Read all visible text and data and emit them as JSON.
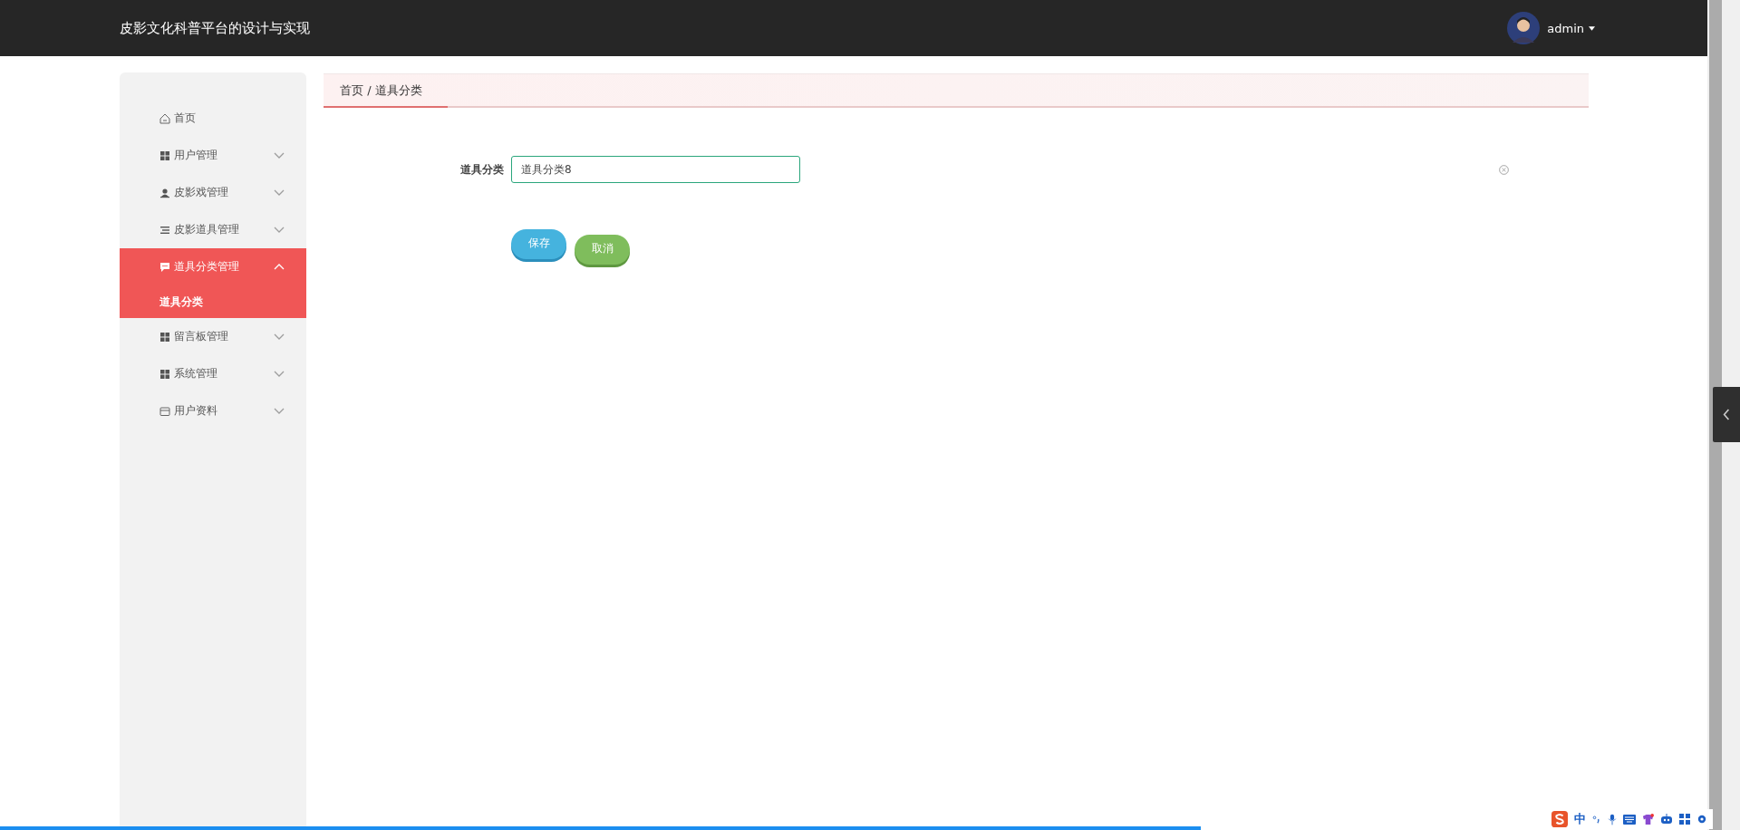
{
  "header": {
    "title": "皮影文化科普平台的设计与实现",
    "user": "admin"
  },
  "sidebar": {
    "items": [
      {
        "label": "首页",
        "kind": "home",
        "selected": false
      },
      {
        "label": "用户管理",
        "kind": "grid",
        "expanded": false,
        "selected": false
      },
      {
        "label": "皮影戏管理",
        "kind": "person",
        "expanded": false,
        "selected": false
      },
      {
        "label": "皮影道具管理",
        "kind": "list",
        "expanded": false,
        "selected": false
      },
      {
        "label": "道具分类管理",
        "kind": "chat",
        "expanded": true,
        "selected": true,
        "children": [
          {
            "label": "道具分类",
            "selected": true
          }
        ]
      },
      {
        "label": "留言板管理",
        "kind": "grid",
        "expanded": false,
        "selected": false
      },
      {
        "label": "系统管理",
        "kind": "grid",
        "expanded": false,
        "selected": false
      },
      {
        "label": "用户资料",
        "kind": "card",
        "expanded": false,
        "selected": false
      }
    ]
  },
  "breadcrumb": "首页 / 道具分类",
  "video_progress": {
    "level": 0.69
  },
  "form": {
    "fields": [
      {
        "label": "道具分类",
        "value": "道具分类8"
      }
    ],
    "buttons": [
      {
        "label": "保存",
        "kind": "save"
      },
      {
        "label": "取消",
        "kind": "cancel"
      }
    ]
  },
  "ime_bar": {
    "mode": "中"
  }
}
